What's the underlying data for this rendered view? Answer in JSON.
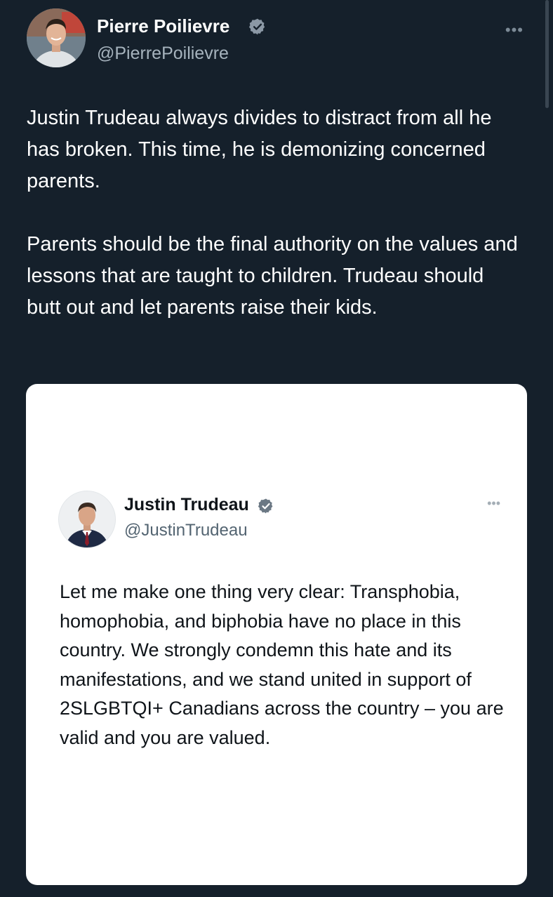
{
  "tweet": {
    "author_name": "Pierre Poilievre",
    "author_handle": "@PierrePoilievre",
    "more_icon": "more-horizontal-icon",
    "verified_icon": "verified-badge-icon",
    "paragraphs": [
      "Justin Trudeau always divides to distract from all he has broken. This time, he is demonizing concerned parents.",
      "Parents should be the final authority on the values and lessons that are taught to children. Trudeau should butt out and let parents raise their kids."
    ]
  },
  "quoted_tweet": {
    "author_name": "Justin Trudeau",
    "author_handle": "@JustinTrudeau",
    "text": "Let me make one thing very clear: Transphobia, homophobia, and biphobia have no place in this country. We strongly condemn this hate and its manifestations, and we stand united in support of 2SLGBTQI+ Canadians across the country – you are valid and you are valued."
  },
  "colors": {
    "background": "#15202b",
    "verified": "#8b98a5",
    "card": "#ffffff"
  }
}
